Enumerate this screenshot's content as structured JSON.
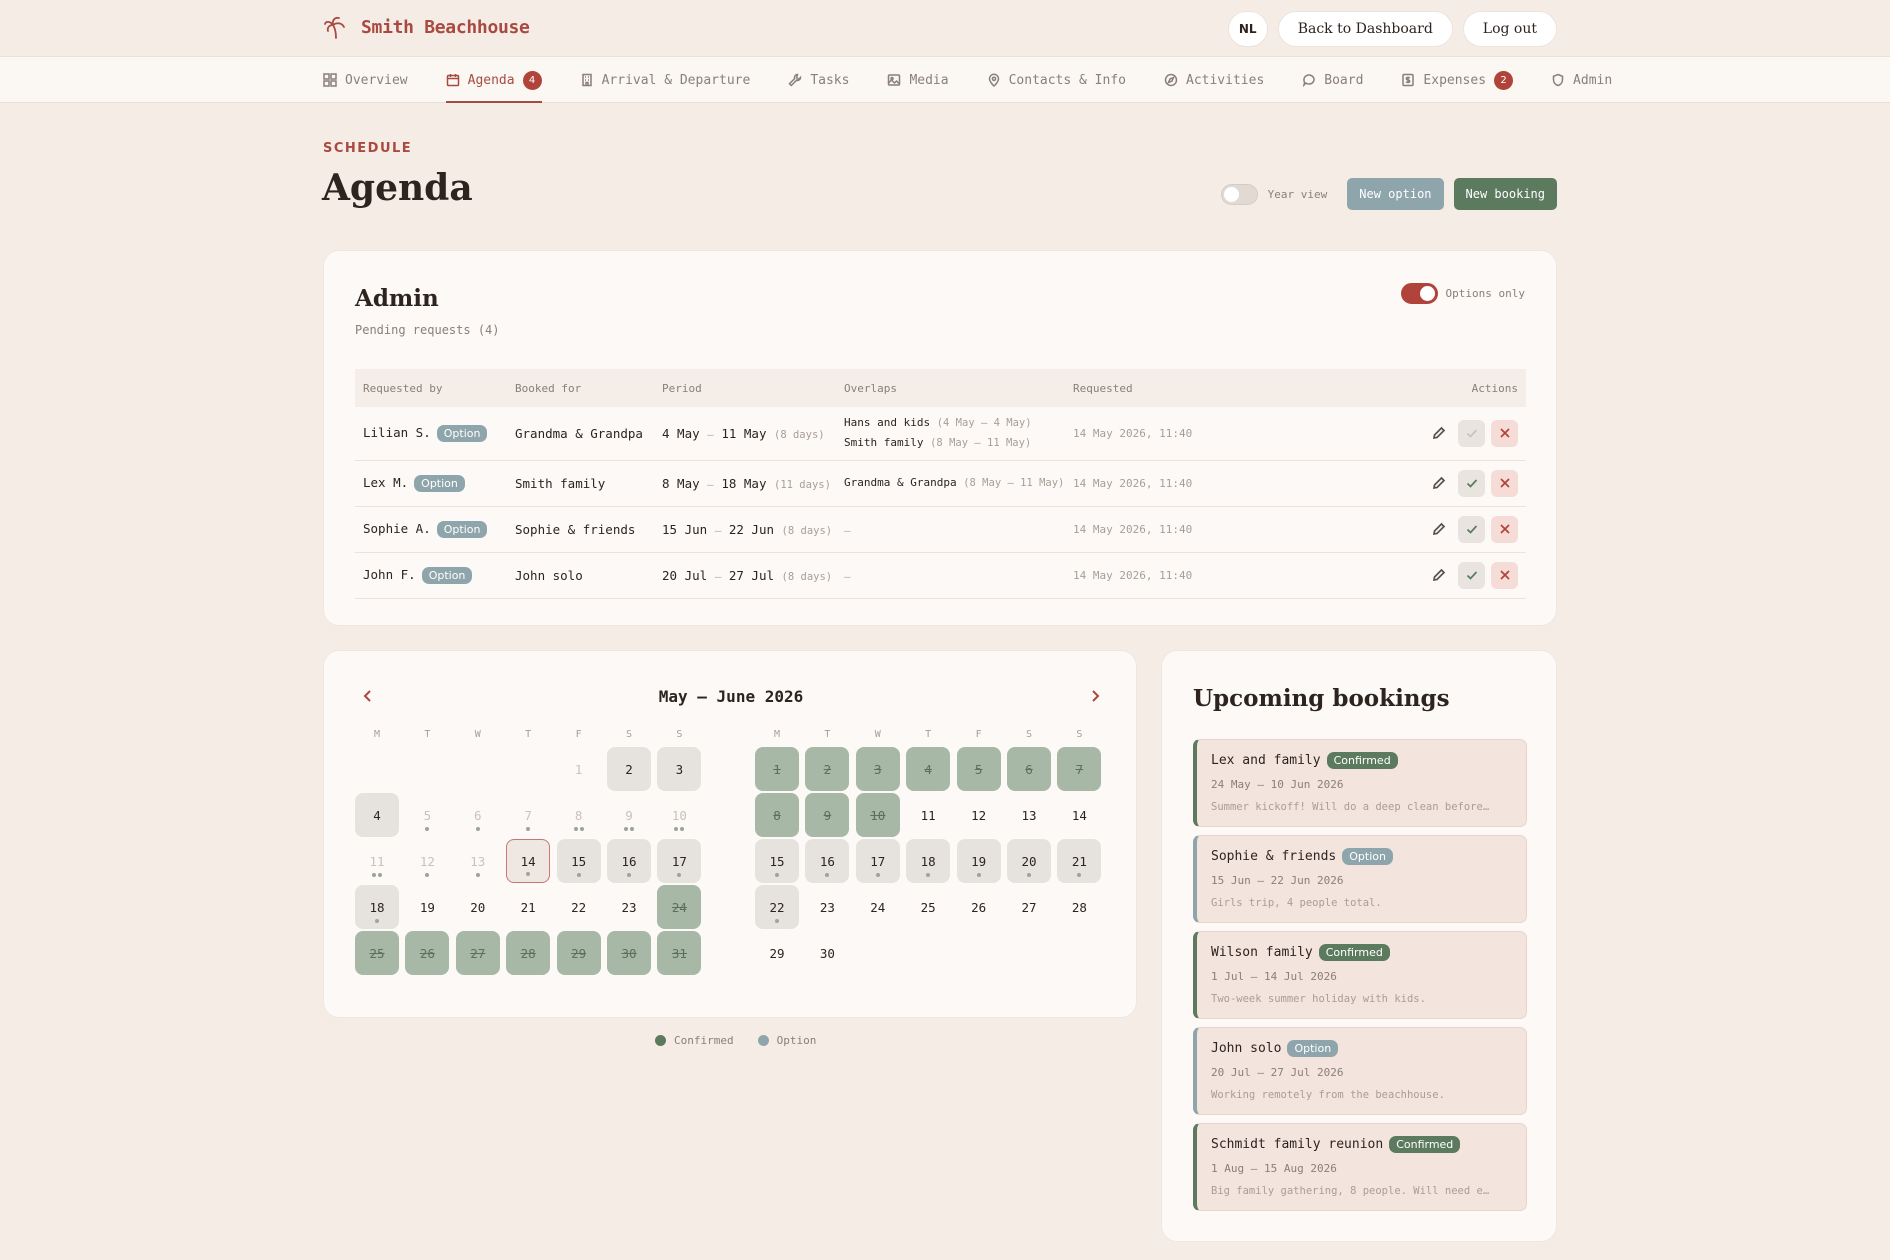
{
  "brand": {
    "name": "Smith Beachhouse"
  },
  "top_actions": {
    "lang": "NL",
    "back": "Back to Dashboard",
    "logout": "Log out"
  },
  "nav": [
    {
      "label": "Overview",
      "icon": "grid-icon"
    },
    {
      "label": "Agenda",
      "icon": "calendar-icon",
      "badge": "4",
      "active": true
    },
    {
      "label": "Arrival & Departure",
      "icon": "building-icon"
    },
    {
      "label": "Tasks",
      "icon": "wrench-icon"
    },
    {
      "label": "Media",
      "icon": "image-icon"
    },
    {
      "label": "Contacts & Info",
      "icon": "pin-icon"
    },
    {
      "label": "Activities",
      "icon": "compass-icon"
    },
    {
      "label": "Board",
      "icon": "chat-icon"
    },
    {
      "label": "Expenses",
      "icon": "receipt-icon",
      "badge": "2"
    },
    {
      "label": "Admin",
      "icon": "shield-icon"
    }
  ],
  "page": {
    "eyebrow": "SCHEDULE",
    "title": "Agenda",
    "year_view": "Year view",
    "new_option": "New option",
    "new_booking": "New booking"
  },
  "admin": {
    "title": "Admin",
    "subtitle": "Pending requests (4)",
    "options_only": "Options only",
    "columns": [
      "Requested by",
      "Booked for",
      "Period",
      "Overlaps",
      "Requested",
      "Actions"
    ],
    "rows": [
      {
        "by": "Lilian S.",
        "tag": "Option",
        "for": "Grandma & Grandpa",
        "start": "4 May",
        "end": "11 May",
        "days": "(8 days)",
        "overlaps": [
          {
            "name": "Hans and kids",
            "range": "(4 May – 4 May)"
          },
          {
            "name": "Smith family",
            "range": "(8 May – 11 May)"
          }
        ],
        "requested": "14 May 2026, 11:40"
      },
      {
        "by": "Lex M.",
        "tag": "Option",
        "for": "Smith family",
        "start": "8 May",
        "end": "18 May",
        "days": "(11 days)",
        "overlaps": [
          {
            "name": "Grandma & Grandpa",
            "range": "(8 May – 11 May)"
          }
        ],
        "requested": "14 May 2026, 11:40"
      },
      {
        "by": "Sophie A.",
        "tag": "Option",
        "for": "Sophie & friends",
        "start": "15 Jun",
        "end": "22 Jun",
        "days": "(8 days)",
        "overlaps": [],
        "requested": "14 May 2026, 11:40"
      },
      {
        "by": "John F.",
        "tag": "Option",
        "for": "John solo",
        "start": "20 Jul",
        "end": "27 Jul",
        "days": "(8 days)",
        "overlaps": [],
        "requested": "14 May 2026, 11:40"
      }
    ],
    "empty_overlap": "—"
  },
  "calendar": {
    "title": "May – June 2026",
    "dow": [
      "M",
      "T",
      "W",
      "T",
      "F",
      "S",
      "S"
    ],
    "may": [
      {
        "d": "1",
        "state": "faded",
        "start": 4
      },
      {
        "d": "2",
        "state": "gray"
      },
      {
        "d": "3",
        "state": "gray"
      },
      {
        "d": "4",
        "state": "gray"
      },
      {
        "d": "5",
        "state": "faded",
        "dots": 1
      },
      {
        "d": "6",
        "state": "faded",
        "dots": 1
      },
      {
        "d": "7",
        "state": "faded",
        "dots": 1
      },
      {
        "d": "8",
        "state": "faded",
        "dots": 2
      },
      {
        "d": "9",
        "state": "faded",
        "dots": 2
      },
      {
        "d": "10",
        "state": "faded",
        "dots": 2
      },
      {
        "d": "11",
        "state": "faded",
        "dots": 2
      },
      {
        "d": "12",
        "state": "faded",
        "dots": 1
      },
      {
        "d": "13",
        "state": "faded",
        "dots": 1
      },
      {
        "d": "14",
        "state": "today",
        "dots": 1
      },
      {
        "d": "15",
        "state": "gray",
        "dots": 1
      },
      {
        "d": "16",
        "state": "gray",
        "dots": 1
      },
      {
        "d": "17",
        "state": "gray",
        "dots": 1
      },
      {
        "d": "18",
        "state": "gray",
        "dots": 1
      },
      {
        "d": "19",
        "state": "plain"
      },
      {
        "d": "20",
        "state": "plain"
      },
      {
        "d": "21",
        "state": "plain"
      },
      {
        "d": "22",
        "state": "plain"
      },
      {
        "d": "23",
        "state": "plain"
      },
      {
        "d": "24",
        "state": "green-strike"
      },
      {
        "d": "25",
        "state": "green-strike"
      },
      {
        "d": "26",
        "state": "green-strike"
      },
      {
        "d": "27",
        "state": "green-strike"
      },
      {
        "d": "28",
        "state": "green-strike"
      },
      {
        "d": "29",
        "state": "green-strike"
      },
      {
        "d": "30",
        "state": "green-strike"
      },
      {
        "d": "31",
        "state": "green-strike"
      }
    ],
    "june": [
      {
        "d": "1",
        "state": "green-strike",
        "start": 0
      },
      {
        "d": "2",
        "state": "green-strike"
      },
      {
        "d": "3",
        "state": "green-strike"
      },
      {
        "d": "4",
        "state": "green-strike"
      },
      {
        "d": "5",
        "state": "green-strike"
      },
      {
        "d": "6",
        "state": "green-strike"
      },
      {
        "d": "7",
        "state": "green-strike"
      },
      {
        "d": "8",
        "state": "green-strike"
      },
      {
        "d": "9",
        "state": "green-strike"
      },
      {
        "d": "10",
        "state": "green-strike"
      },
      {
        "d": "11",
        "state": "plain"
      },
      {
        "d": "12",
        "state": "plain"
      },
      {
        "d": "13",
        "state": "plain"
      },
      {
        "d": "14",
        "state": "plain"
      },
      {
        "d": "15",
        "state": "gray",
        "dots": 1
      },
      {
        "d": "16",
        "state": "gray",
        "dots": 1
      },
      {
        "d": "17",
        "state": "gray",
        "dots": 1
      },
      {
        "d": "18",
        "state": "gray",
        "dots": 1
      },
      {
        "d": "19",
        "state": "gray",
        "dots": 1
      },
      {
        "d": "20",
        "state": "gray",
        "dots": 1
      },
      {
        "d": "21",
        "state": "gray",
        "dots": 1
      },
      {
        "d": "22",
        "state": "gray",
        "dots": 1
      },
      {
        "d": "23",
        "state": "plain"
      },
      {
        "d": "24",
        "state": "plain"
      },
      {
        "d": "25",
        "state": "plain"
      },
      {
        "d": "26",
        "state": "plain"
      },
      {
        "d": "27",
        "state": "plain"
      },
      {
        "d": "28",
        "state": "plain"
      },
      {
        "d": "29",
        "state": "plain"
      },
      {
        "d": "30",
        "state": "plain"
      }
    ],
    "legend": [
      {
        "label": "Confirmed",
        "color": "#5c7a5e"
      },
      {
        "label": "Option",
        "color": "#8fa5ac"
      }
    ]
  },
  "upcoming": {
    "title": "Upcoming bookings",
    "items": [
      {
        "name": "Lex and family",
        "status": "Confirmed",
        "dates": "24 May — 10 Jun 2026",
        "note": "Summer kickoff! Will do a deep clean before…"
      },
      {
        "name": "Sophie & friends",
        "status": "Option",
        "dates": "15 Jun — 22 Jun 2026",
        "note": "Girls trip, 4 people total."
      },
      {
        "name": "Wilson family",
        "status": "Confirmed",
        "dates": "1 Jul — 14 Jul 2026",
        "note": "Two-week summer holiday with kids."
      },
      {
        "name": "John solo",
        "status": "Option",
        "dates": "20 Jul — 27 Jul 2026",
        "note": "Working remotely from the beachhouse."
      },
      {
        "name": "Schmidt family reunion",
        "status": "Confirmed",
        "dates": "1 Aug — 15 Aug 2026",
        "note": "Big family gathering, 8 people. Will need e…"
      }
    ]
  },
  "colors": {
    "accent": "#a84a40",
    "confirmed": "#5c7a5e",
    "option": "#8fa5ac",
    "background": "#f6ece6"
  }
}
